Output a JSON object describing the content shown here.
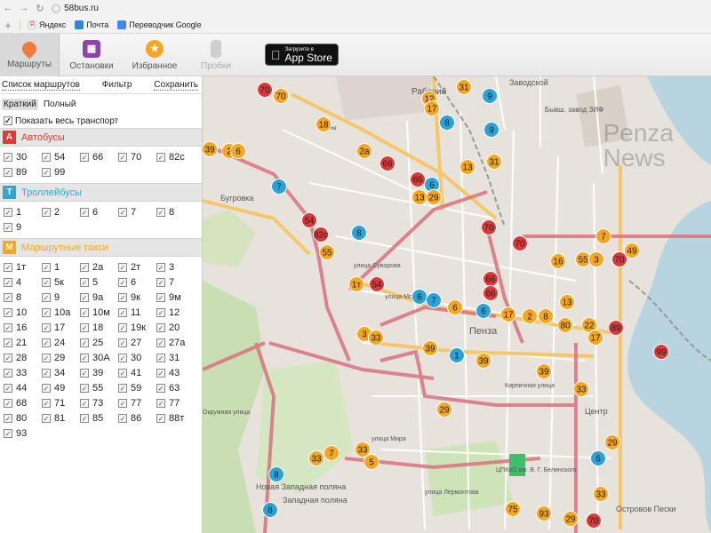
{
  "browser": {
    "url": "58bus.ru",
    "bookmarks": [
      {
        "label": "Яндекс",
        "color": "#e53935"
      },
      {
        "label": "Почта",
        "color": "#2f86d1"
      },
      {
        "label": "Переводчик Google",
        "color": "#4285f4"
      }
    ]
  },
  "toolbar": {
    "routes_label": "Маршруты",
    "stops_label": "Остановки",
    "favorites_label": "Избранное",
    "traffic_label": "Пробки",
    "appstore_small": "Загрузите в",
    "appstore_big": "App Store"
  },
  "sidebar": {
    "tab_list": "Список маршрутов",
    "tab_filter": "Фильтр",
    "tab_save": "Сохранить",
    "view_short": "Краткий",
    "view_full": "Полный",
    "show_all": "Показать весь транспорт",
    "sections": [
      {
        "icon": "А",
        "title": "Автобусы",
        "color": "#e53935",
        "routes": [
          "30",
          "54",
          "66",
          "70",
          "82с",
          "89",
          "99"
        ]
      },
      {
        "icon": "Т",
        "title": "Троллейбусы",
        "color": "#29a8d8",
        "routes": [
          "1",
          "2",
          "6",
          "7",
          "8",
          "9"
        ]
      },
      {
        "icon": "М",
        "title": "Маршрутные такси",
        "color": "#f5a623",
        "routes": [
          "1т",
          "1",
          "2а",
          "2т",
          "3",
          "4",
          "5к",
          "5",
          "6",
          "7",
          "8",
          "9",
          "9а",
          "9к",
          "9м",
          "10",
          "10а",
          "10м",
          "11",
          "12",
          "16",
          "17",
          "18",
          "19к",
          "20",
          "21",
          "24",
          "25",
          "27",
          "27а",
          "28",
          "29",
          "30А",
          "30",
          "31",
          "33",
          "34",
          "39",
          "41",
          "43",
          "44",
          "49",
          "55",
          "59",
          "63",
          "68",
          "71",
          "73",
          "77",
          "77",
          "80",
          "81",
          "85",
          "86",
          "88т",
          "93"
        ]
      }
    ]
  },
  "map": {
    "watermark_line1": "Penza",
    "watermark_line2": "News",
    "labels": [
      "Рабочий",
      "Бугровка",
      "Пенза",
      "Заводской",
      "Бывш. завод ЗИФ",
      "Новая Западная поляна",
      "Западная поляна",
      "Центр",
      "Островов Пески",
      "улица Мира",
      "улица Суворова",
      "улица Московская",
      "улица Лермонтова",
      "Кирпичная улица",
      "ЦПКиО им. В. Г. Белинского",
      "Ахуны",
      "Окружная улица"
    ],
    "markers": [
      {
        "t": "М",
        "v": "70"
      },
      {
        "t": "М",
        "v": "31"
      },
      {
        "t": "Т",
        "v": "9"
      },
      {
        "t": "А",
        "v": "70"
      },
      {
        "t": "М",
        "v": "12"
      },
      {
        "t": "М",
        "v": "17"
      },
      {
        "t": "Т",
        "v": "8"
      },
      {
        "t": "М",
        "v": "18"
      },
      {
        "t": "Т",
        "v": "9"
      },
      {
        "t": "М",
        "v": "39"
      },
      {
        "t": "М",
        "v": "2"
      },
      {
        "t": "М",
        "v": "6"
      },
      {
        "t": "М",
        "v": "2а"
      },
      {
        "t": "А",
        "v": "66"
      },
      {
        "t": "М",
        "v": "13"
      },
      {
        "t": "М",
        "v": "31"
      },
      {
        "t": "Т",
        "v": "7"
      },
      {
        "t": "А",
        "v": "66"
      },
      {
        "t": "Т",
        "v": "6"
      },
      {
        "t": "М",
        "v": "13"
      },
      {
        "t": "М",
        "v": "29"
      },
      {
        "t": "А",
        "v": "70"
      },
      {
        "t": "А",
        "v": "54"
      },
      {
        "t": "А",
        "v": "82с"
      },
      {
        "t": "Т",
        "v": "8"
      },
      {
        "t": "М",
        "v": "55"
      },
      {
        "t": "А",
        "v": "70"
      },
      {
        "t": "М",
        "v": "7"
      },
      {
        "t": "М",
        "v": "16"
      },
      {
        "t": "М",
        "v": "55"
      },
      {
        "t": "М",
        "v": "3"
      },
      {
        "t": "А",
        "v": "70"
      },
      {
        "t": "М",
        "v": "49"
      },
      {
        "t": "М",
        "v": "1т"
      },
      {
        "t": "А",
        "v": "54"
      },
      {
        "t": "А",
        "v": "66"
      },
      {
        "t": "А",
        "v": "66"
      },
      {
        "t": "Т",
        "v": "6"
      },
      {
        "t": "Т",
        "v": "7"
      },
      {
        "t": "М",
        "v": "6"
      },
      {
        "t": "Т",
        "v": "6"
      },
      {
        "t": "М",
        "v": "17"
      },
      {
        "t": "М",
        "v": "2"
      },
      {
        "t": "М",
        "v": "8"
      },
      {
        "t": "М",
        "v": "13"
      },
      {
        "t": "М",
        "v": "80"
      },
      {
        "t": "М",
        "v": "22"
      },
      {
        "t": "А",
        "v": "89"
      },
      {
        "t": "М",
        "v": "17"
      },
      {
        "t": "М",
        "v": "3"
      },
      {
        "t": "М",
        "v": "33"
      },
      {
        "t": "М",
        "v": "39"
      },
      {
        "t": "Т",
        "v": "1"
      },
      {
        "t": "М",
        "v": "39"
      },
      {
        "t": "М",
        "v": "39"
      },
      {
        "t": "М",
        "v": "33"
      },
      {
        "t": "А",
        "v": "99"
      },
      {
        "t": "М",
        "v": "29"
      },
      {
        "t": "М",
        "v": "33"
      },
      {
        "t": "М",
        "v": "7"
      },
      {
        "t": "М",
        "v": "33"
      },
      {
        "t": "М",
        "v": "5"
      },
      {
        "t": "Т",
        "v": "8"
      },
      {
        "t": "М",
        "v": "75"
      },
      {
        "t": "М",
        "v": "93"
      },
      {
        "t": "М",
        "v": "29"
      },
      {
        "t": "А",
        "v": "70"
      },
      {
        "t": "Т",
        "v": "6"
      },
      {
        "t": "Т",
        "v": "8"
      },
      {
        "t": "М",
        "v": "29"
      },
      {
        "t": "М",
        "v": "33"
      }
    ]
  }
}
